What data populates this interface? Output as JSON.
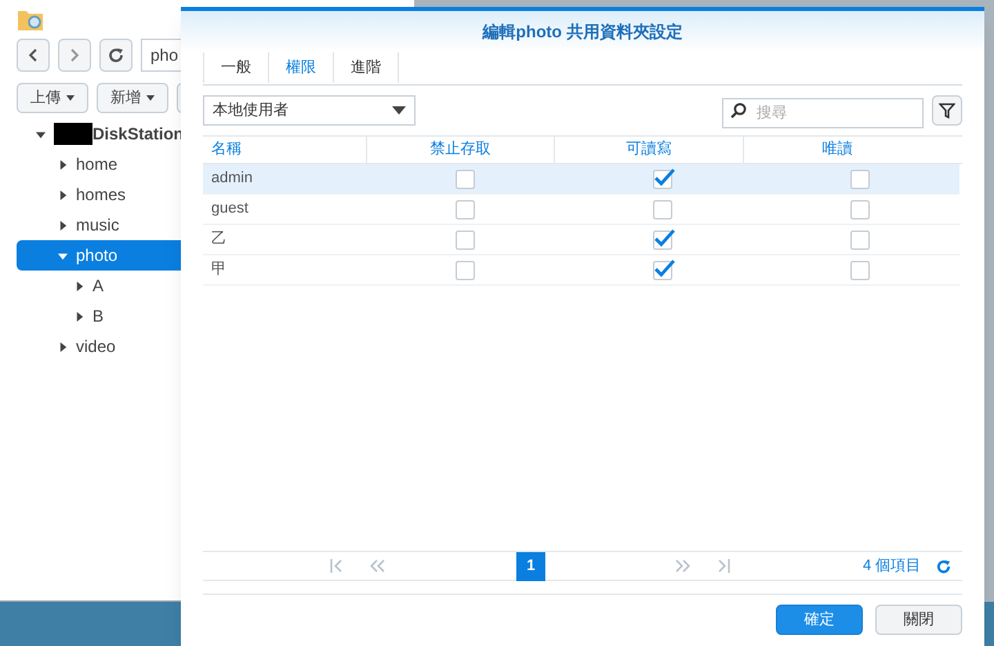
{
  "file_window": {
    "path": "pho",
    "toolbar": [
      "上傳",
      "新增"
    ],
    "tree": [
      {
        "label": "DiskStation",
        "redacted": true,
        "expanded": true,
        "selected": false,
        "children": [
          {
            "label": "home",
            "expanded": false,
            "selected": false
          },
          {
            "label": "homes",
            "expanded": false,
            "selected": false
          },
          {
            "label": "music",
            "expanded": false,
            "selected": false
          },
          {
            "label": "photo",
            "expanded": true,
            "selected": true,
            "children": [
              {
                "label": "A",
                "expanded": false,
                "selected": false
              },
              {
                "label": "B",
                "expanded": false,
                "selected": false
              }
            ]
          },
          {
            "label": "video",
            "expanded": false,
            "selected": false
          }
        ]
      }
    ]
  },
  "dialog": {
    "title": "編輯photo 共用資料夾設定",
    "tabs": [
      {
        "label": "一般",
        "selected": false
      },
      {
        "label": "權限",
        "selected": true
      },
      {
        "label": "進階",
        "selected": false
      }
    ],
    "user_type": "本地使用者",
    "search": {
      "placeholder": "搜尋"
    },
    "table": {
      "columns": [
        "名稱",
        "禁止存取",
        "可讀寫",
        "唯讀"
      ],
      "rows": [
        {
          "name": "admin",
          "selected": true,
          "checks": [
            {
              "checked": false
            },
            {
              "checked": true
            },
            {
              "checked": false
            }
          ]
        },
        {
          "name": "guest",
          "selected": false,
          "checks": [
            {
              "checked": false
            },
            {
              "checked": false
            },
            {
              "checked": false
            }
          ]
        },
        {
          "name": "乙",
          "selected": false,
          "checks": [
            {
              "checked": false
            },
            {
              "checked": true
            },
            {
              "checked": false
            }
          ]
        },
        {
          "name": "甲",
          "selected": false,
          "checks": [
            {
              "checked": false
            },
            {
              "checked": true
            },
            {
              "checked": false
            }
          ]
        }
      ]
    },
    "pager": {
      "page": "1",
      "count": "4 個項目"
    },
    "buttons": [
      {
        "label": "確定",
        "kind": "primary"
      },
      {
        "label": "關閉",
        "kind": "secondary"
      }
    ]
  }
}
